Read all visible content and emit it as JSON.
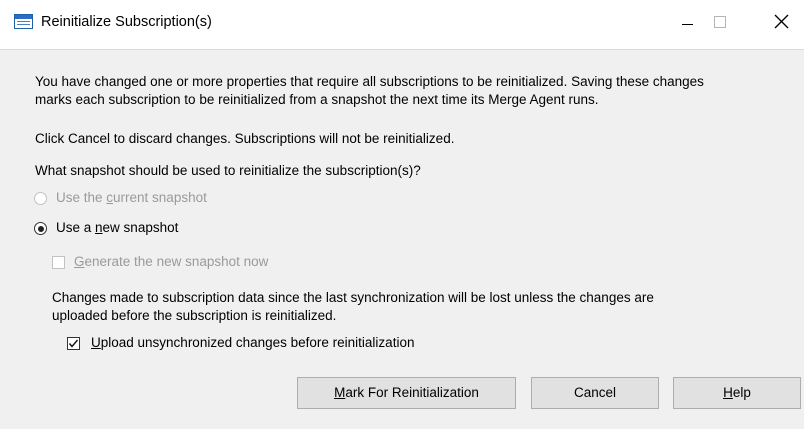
{
  "window": {
    "title": "Reinitialize Subscription(s)",
    "icon": "dialog-window-icon"
  },
  "message": {
    "line1": "You have changed one or more properties that require all subscriptions to be reinitialized. Saving these changes",
    "line2": "marks each subscription to be reinitialized from a snapshot the next time its Merge Agent runs.",
    "cancel_info": "Click Cancel to discard changes. Subscriptions will not be reinitialized.",
    "question": "What snapshot should be used to reinitialize the subscription(s)?"
  },
  "options": {
    "current_snapshot": {
      "label_pre": "Use the ",
      "label_key": "c",
      "label_post": "urrent snapshot",
      "selected": false,
      "enabled": false
    },
    "new_snapshot": {
      "label_pre": "Use a ",
      "label_key": "n",
      "label_post": "ew snapshot",
      "selected": true,
      "enabled": true
    },
    "generate_now": {
      "label_key": "G",
      "label_post": "enerate the new snapshot now",
      "checked": false,
      "enabled": false
    }
  },
  "sync_warning": {
    "line1": "Changes made to subscription data since the last synchronization will be lost unless the changes are",
    "line2": "uploaded before the subscription is reinitialized."
  },
  "upload": {
    "label_key": "U",
    "label_post": "pload unsynchronized changes before reinitialization",
    "checked": true
  },
  "buttons": {
    "mark": {
      "label_key": "M",
      "label_post": "ark For Reinitialization"
    },
    "cancel": "Cancel",
    "help": {
      "label_key": "H",
      "label_post": "elp"
    }
  },
  "colors": {
    "dialog_bg": "#f0f0f0",
    "disabled_text": "#9a9a9a",
    "button_bg": "#e1e1e1"
  }
}
